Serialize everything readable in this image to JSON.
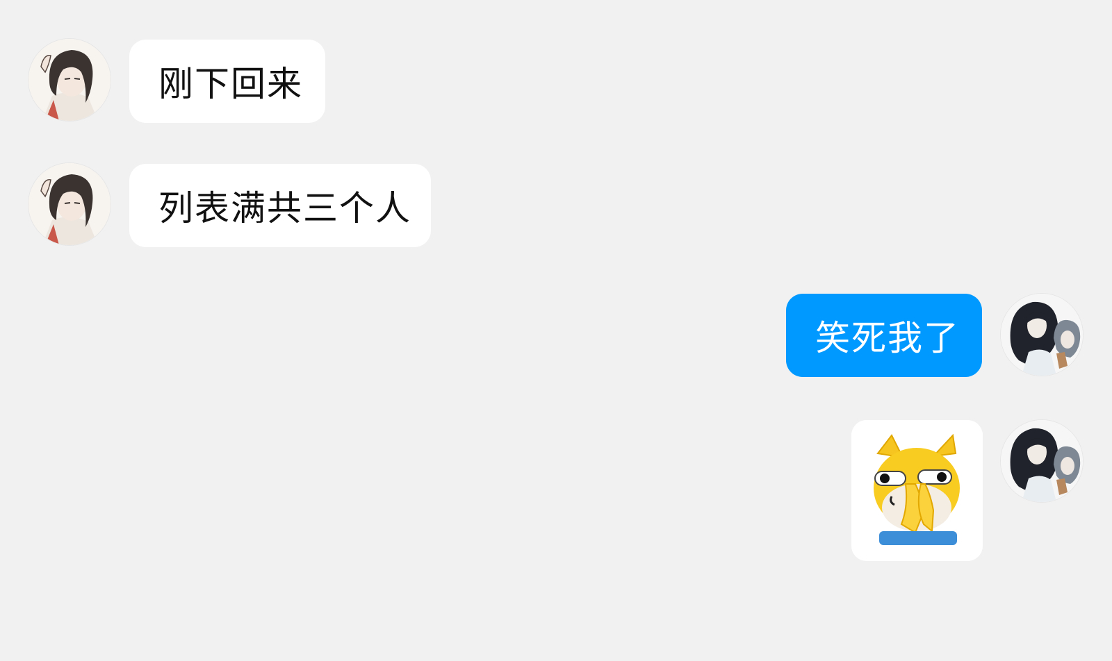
{
  "conversation": {
    "messages": [
      {
        "direction": "incoming",
        "type": "text",
        "text": "刚下回来"
      },
      {
        "direction": "incoming",
        "type": "text",
        "text": "列表满共三个人"
      },
      {
        "direction": "outgoing",
        "type": "text",
        "text": "笑死我了"
      },
      {
        "direction": "outgoing",
        "type": "sticker",
        "sticker": "yellow-cat-praying-hands-sticker"
      }
    ]
  },
  "colors": {
    "background": "#f1f1f1",
    "incoming_bubble": "#ffffff",
    "outgoing_bubble": "#0099ff"
  }
}
